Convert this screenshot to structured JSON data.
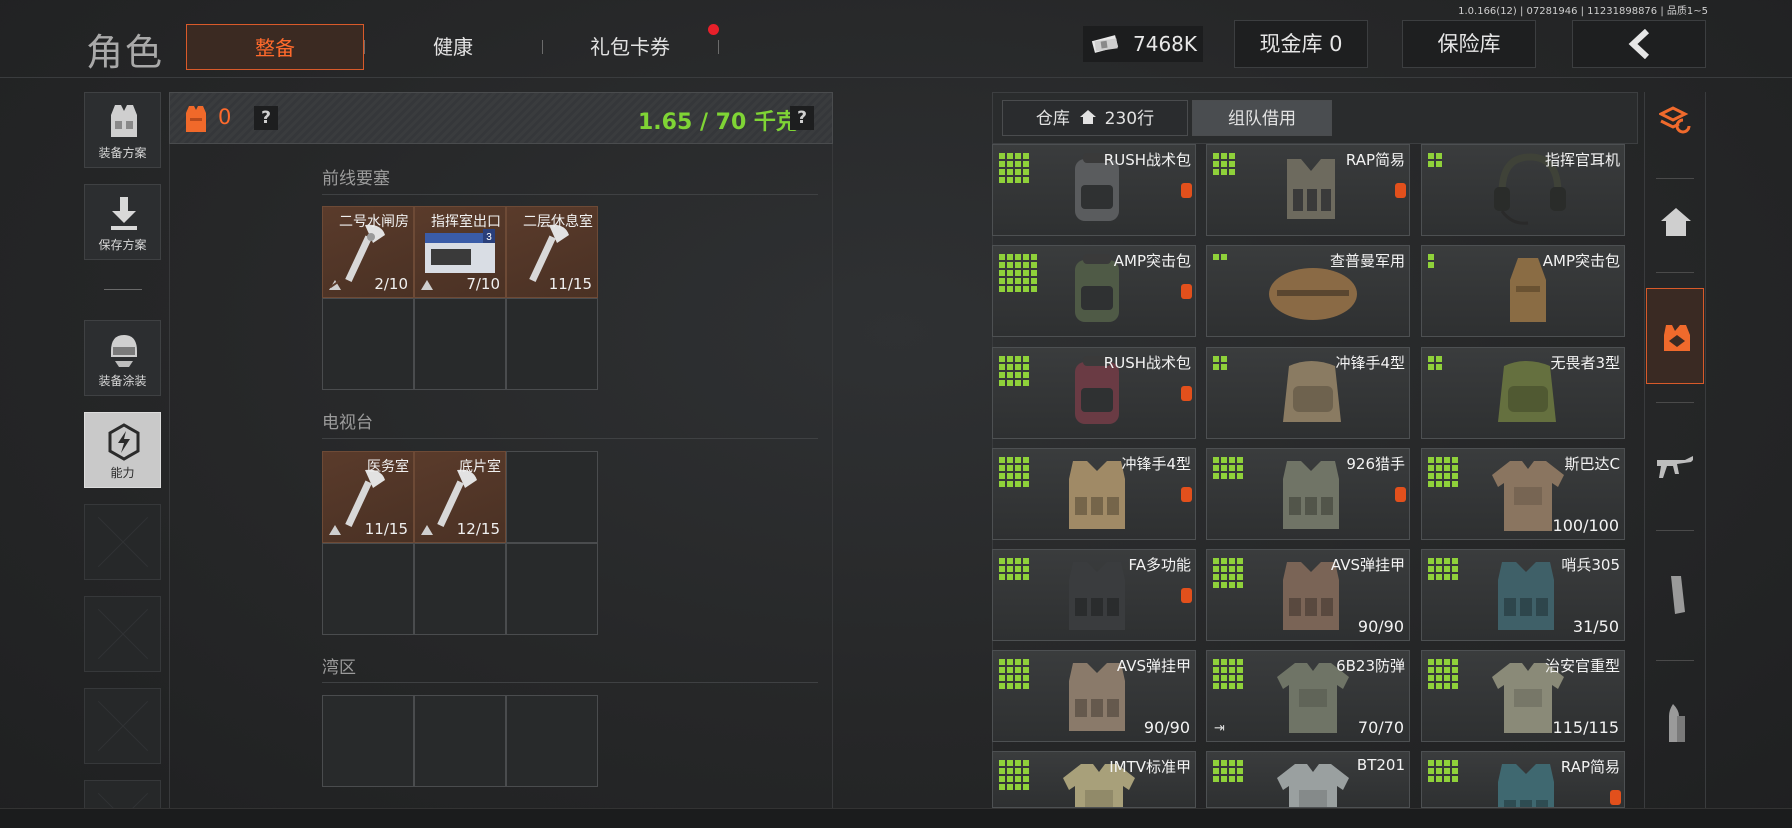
{
  "version_info": "1.0.166(12) | 07281946 | 11231898876 | 品质1~5",
  "header": {
    "title": "角色",
    "tabs": [
      {
        "label": "整备",
        "active": true
      },
      {
        "label": "健康",
        "active": false
      },
      {
        "label": "礼包卡券",
        "active": false,
        "notify": true
      }
    ],
    "money": "7468K",
    "cash_vault": "现金库 0",
    "safe_box": "保险库"
  },
  "left_menu": [
    {
      "label": "装备方案",
      "icon": "vest-loadout-icon"
    },
    {
      "label": "保存方案",
      "icon": "download-icon"
    },
    {
      "label": "装备涂装",
      "icon": "helmet-skin-icon"
    },
    {
      "label": "能力",
      "icon": "ability-icon"
    }
  ],
  "mid": {
    "vest_count": "0",
    "help": "?",
    "weight": "1.65 / 70 千克",
    "sections": [
      {
        "title": "前线要塞",
        "slots": [
          {
            "name": "二号水闸房",
            "count": "2/10",
            "type": "key"
          },
          {
            "name": "指挥室出口",
            "count": "7/10",
            "type": "card"
          },
          {
            "name": "二层休息室",
            "count": "11/15",
            "type": "key"
          }
        ]
      },
      {
        "title": "电视台",
        "slots": [
          {
            "name": "医务室",
            "count": "11/15",
            "type": "key"
          },
          {
            "name": "底片室",
            "count": "12/15",
            "type": "key"
          }
        ]
      },
      {
        "title": "湾区",
        "slots": []
      }
    ]
  },
  "storage": {
    "tab_warehouse": "仓库",
    "tab_rows": "230行",
    "tab_team": "组队借用",
    "items": [
      {
        "name": "RUSH战术包",
        "count": "",
        "grid": [
          4,
          4
        ],
        "lock": true,
        "art": "backpack",
        "color": "#5a5c5e"
      },
      {
        "name": "RAP简易",
        "count": "",
        "grid": [
          3,
          3
        ],
        "lock": true,
        "art": "rig",
        "color": "#6d6a5e"
      },
      {
        "name": "指挥官耳机",
        "count": "",
        "grid": [
          2,
          2
        ],
        "lock": false,
        "art": "headset",
        "color": "#3f4238"
      },
      {
        "name": "AMP突击包",
        "count": "",
        "grid": [
          5,
          5
        ],
        "lock": true,
        "art": "backpack",
        "color": "#4f5a46"
      },
      {
        "name": "查普曼军用",
        "count": "",
        "grid": [
          2,
          1
        ],
        "lock": false,
        "art": "duffel",
        "color": "#8a6a45"
      },
      {
        "name": "AMP突击包",
        "count": "",
        "grid": [
          1,
          2
        ],
        "lock": false,
        "art": "sack",
        "color": "#8a6c44"
      },
      {
        "name": "RUSH战术包",
        "count": "",
        "grid": [
          4,
          4
        ],
        "lock": true,
        "art": "backpack",
        "color": "#6a3b44"
      },
      {
        "name": "冲锋手4型",
        "count": "",
        "grid": [
          2,
          2
        ],
        "lock": false,
        "art": "bigpack",
        "color": "#8a7b62"
      },
      {
        "name": "无畏者3型",
        "count": "",
        "grid": [
          2,
          2
        ],
        "lock": false,
        "art": "bigpack",
        "color": "#65703f"
      },
      {
        "name": "冲锋手4型",
        "count": "",
        "grid": [
          4,
          4
        ],
        "lock": true,
        "art": "vest",
        "color": "#a08a66"
      },
      {
        "name": "926猎手",
        "count": "",
        "grid": [
          4,
          3
        ],
        "lock": true,
        "art": "vest",
        "color": "#707466"
      },
      {
        "name": "斯巴达C",
        "count": "100/100",
        "grid": [
          4,
          4
        ],
        "lock": false,
        "art": "armor",
        "color": "#8a7560"
      },
      {
        "name": "FA多功能",
        "count": "",
        "grid": [
          4,
          3
        ],
        "lock": true,
        "art": "vest",
        "color": "#3a3c3e"
      },
      {
        "name": "AVS弹挂甲",
        "count": "90/90",
        "grid": [
          4,
          4
        ],
        "lock": false,
        "art": "vest",
        "color": "#7a6456"
      },
      {
        "name": "哨兵305",
        "count": "31/50",
        "grid": [
          4,
          3
        ],
        "lock": false,
        "art": "vest",
        "color": "#3f6068"
      },
      {
        "name": "AVS弹挂甲",
        "count": "90/90",
        "grid": [
          4,
          4
        ],
        "lock": false,
        "art": "vest",
        "color": "#8a7a6a"
      },
      {
        "name": "6B23防弹",
        "count": "70/70",
        "grid": [
          4,
          4
        ],
        "lock": false,
        "art": "armor",
        "color": "#6f7466",
        "exit": true
      },
      {
        "name": "治安官重型",
        "count": "115/115",
        "grid": [
          4,
          4
        ],
        "lock": false,
        "art": "armor",
        "color": "#8a8a78"
      },
      {
        "name": "IMTV标准甲",
        "count": "",
        "grid": [
          4,
          4
        ],
        "lock": false,
        "art": "armor",
        "color": "#a8a07a"
      },
      {
        "name": "BT201",
        "count": "",
        "grid": [
          4,
          3
        ],
        "lock": false,
        "art": "armor",
        "color": "#9aa0a0"
      },
      {
        "name": "RAP简易",
        "count": "",
        "grid": [
          4,
          3
        ],
        "lock": true,
        "art": "vest",
        "color": "#3f6870"
      }
    ]
  },
  "right_categories": [
    "refresh-stack-icon",
    "home-icon",
    "gear-case-icon",
    "rifle-icon",
    "magazine-icon",
    "bullet-icon"
  ],
  "colors": {
    "accent": "#ff6a2c",
    "green": "#8fd13a",
    "weight_green": "#7fd435"
  }
}
